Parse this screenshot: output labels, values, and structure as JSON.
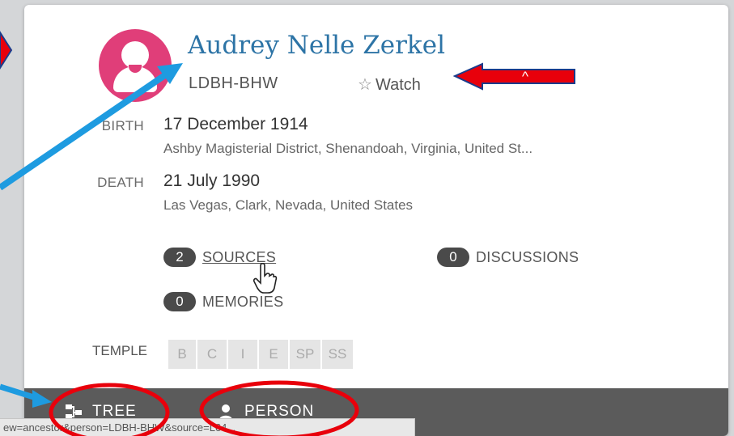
{
  "person": {
    "name": "Audrey Nelle Zerkel",
    "id": "LDBH-BHW",
    "watch_label": "Watch"
  },
  "birth": {
    "label": "BIRTH",
    "date": "17 December 1914",
    "place": "Ashby Magisterial District, Shenandoah, Virginia, United St..."
  },
  "death": {
    "label": "DEATH",
    "date": "21 July 1990",
    "place": "Las Vegas, Clark, Nevada, United States"
  },
  "counters": {
    "sources": {
      "count": "2",
      "label": "SOURCES"
    },
    "discussions": {
      "count": "0",
      "label": "DISCUSSIONS"
    },
    "memories": {
      "count": "0",
      "label": "MEMORIES"
    }
  },
  "temple": {
    "label": "TEMPLE",
    "ordinances": [
      "B",
      "C",
      "I",
      "E",
      "SP",
      "SS"
    ]
  },
  "footer": {
    "tree_label": "TREE",
    "person_label": "PERSON"
  },
  "status_bar": {
    "url": "ew=ancestor&person=LDBH-BHW&source=L64..."
  },
  "annotations": {
    "arrow_label": "^",
    "colors": {
      "red": "#e8000b",
      "blue": "#1e9be0",
      "avatar": "#e03e79",
      "name": "#2d74a6"
    }
  }
}
